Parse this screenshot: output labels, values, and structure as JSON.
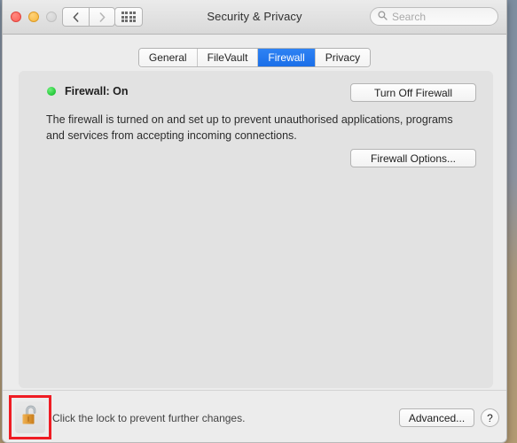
{
  "window": {
    "title": "Security & Privacy",
    "traffic_lights": [
      {
        "name": "close",
        "color": "#fa5e57"
      },
      {
        "name": "minimize",
        "color": "#f6b73c"
      },
      {
        "name": "zoom",
        "color": "#d2d2d2"
      }
    ],
    "nav": {
      "back_icon": "chevron-left-icon",
      "forward_icon": "chevron-right-icon",
      "grid_icon": "show-all-grid-icon"
    },
    "search": {
      "placeholder": "Search",
      "value": "",
      "icon": "search-icon"
    }
  },
  "tabs": [
    {
      "label": "General",
      "active": false
    },
    {
      "label": "FileVault",
      "active": false
    },
    {
      "label": "Firewall",
      "active": true
    },
    {
      "label": "Privacy",
      "active": false
    }
  ],
  "main": {
    "status_label": "Firewall: On",
    "status_dot_color": "#23c739",
    "turn_off_label": "Turn Off Firewall",
    "description": "The firewall is turned on and set up to prevent unauthorised applications, programs and services from accepting incoming connections.",
    "firewall_options_label": "Firewall Options..."
  },
  "bottom": {
    "lock_icon": "unlocked-padlock-icon",
    "lock_note": "Click the lock to prevent further changes.",
    "advanced_label": "Advanced...",
    "help_label": "?",
    "highlight_color": "#ef1c23"
  }
}
